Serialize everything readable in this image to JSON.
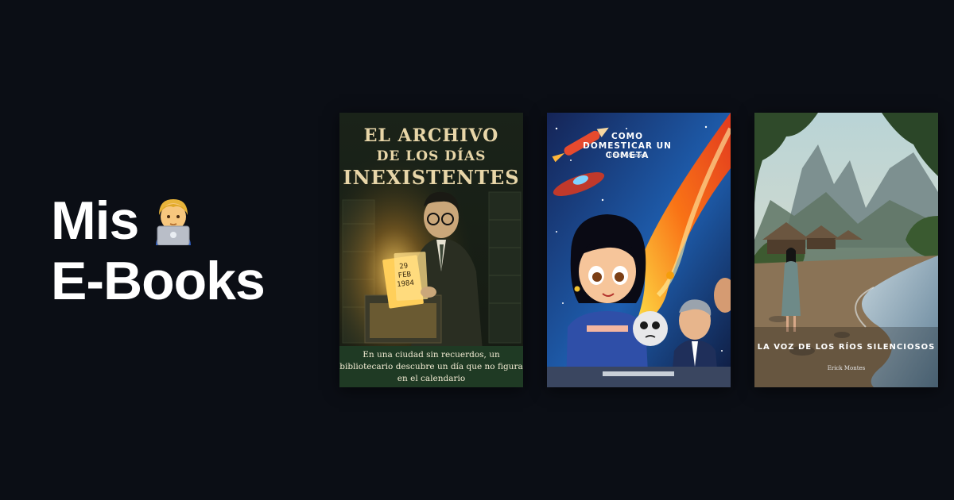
{
  "hero": {
    "line1": "Mis",
    "line2": "E-Books",
    "emoji_icon": "technologist-with-laptop-emoji"
  },
  "books": [
    {
      "title_line1": "EL ARCHIVO",
      "title_line2": "DE LOS DÍAS",
      "title_line3": "INEXISTENTES",
      "date_card": "29\nFEB\n1984",
      "blurb": "En una ciudad sin recuerdos, un bibliotecario descubre un día que no figura en el calendario",
      "colors": {
        "background": "#1c2418",
        "accent": "#e8d6a8",
        "band": "#1f3a24"
      }
    },
    {
      "title": "COMO DOMESTICAR UN COMETA",
      "author": "Erick Montes",
      "colors": {
        "sky": "#1e3a8a",
        "comet": "#f97316"
      }
    },
    {
      "title": "LA VOZ DE LOS RÍOS SILENCIOSOS",
      "author": "Erick Montes",
      "colors": {
        "sky": "#a9c4c6",
        "river": "#7fa0b6"
      }
    }
  ]
}
